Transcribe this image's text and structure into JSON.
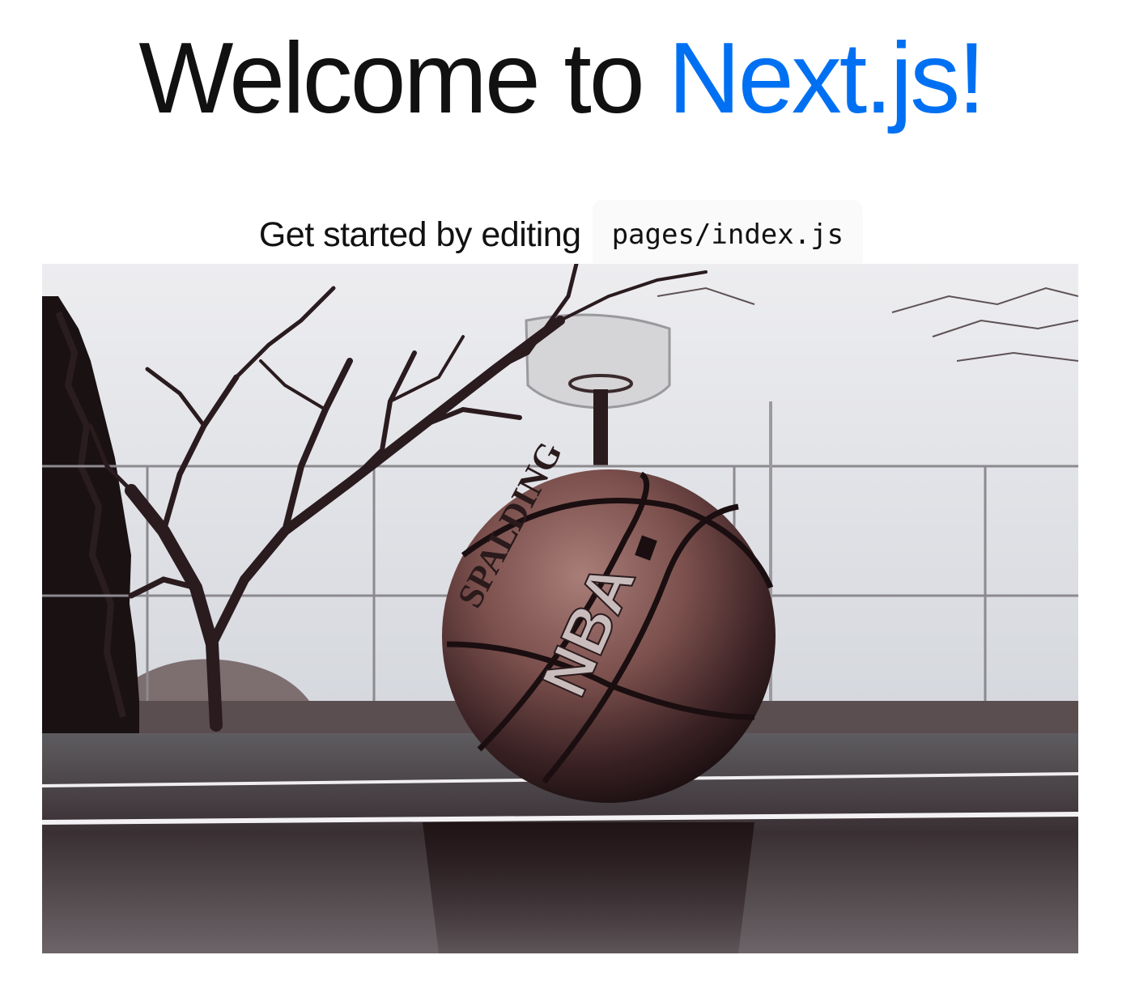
{
  "title": {
    "prefix": "Welcome to ",
    "link_text": "Next.js!"
  },
  "description": {
    "text": "Get started by editing",
    "code": "pages/index.js"
  },
  "hero_image": {
    "ball_brand": "SPALDING",
    "ball_league": "NBA"
  },
  "colors": {
    "link": "#0070f3",
    "text": "#111111",
    "code_background": "#fafafa"
  }
}
